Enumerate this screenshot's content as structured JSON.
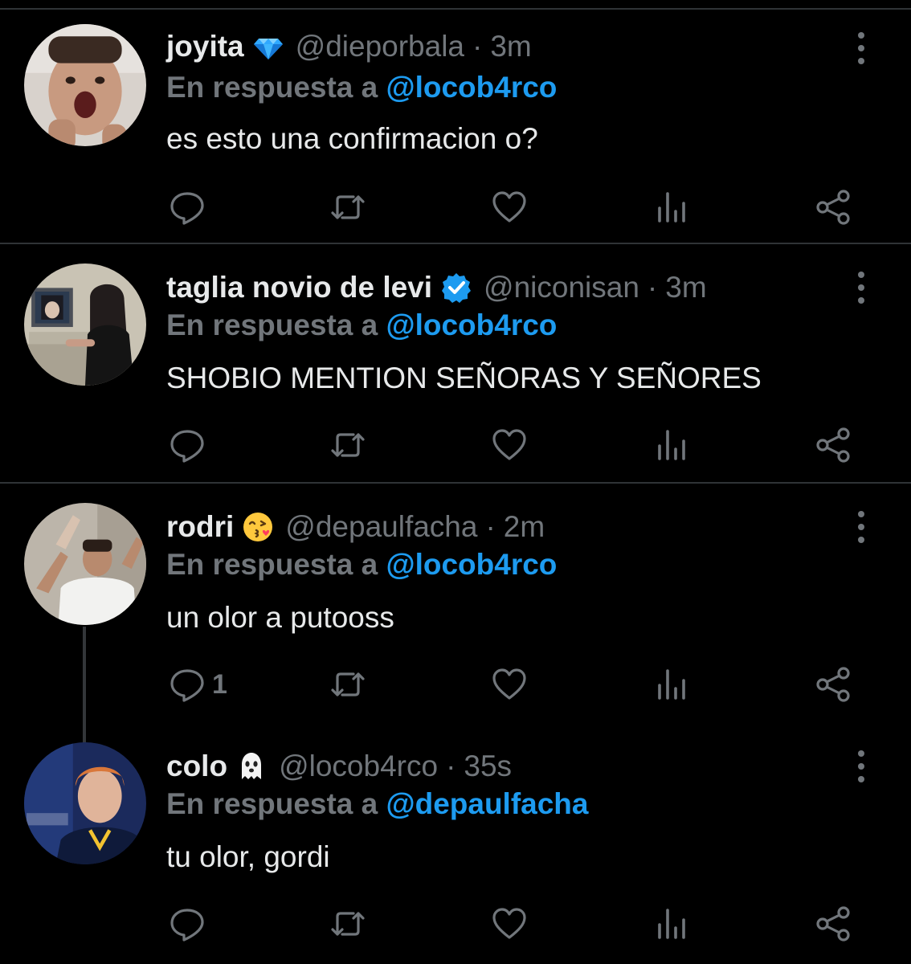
{
  "reply_prefix": "En respuesta a",
  "tweets": [
    {
      "name": "joyita",
      "badge": "gem-emoji",
      "handle": "@dieporbala",
      "separator": "·",
      "time": "3m",
      "reply_to": "@locob4rco",
      "text": "es esto una confirmacion o?",
      "reply_count": ""
    },
    {
      "name": "taglia novio de levi",
      "badge": "verified-badge",
      "handle": "@niconisan",
      "separator": "·",
      "time": "3m",
      "reply_to": "@locob4rco",
      "text": "SHOBIO MENTION SEÑORAS Y SEÑORES",
      "reply_count": ""
    },
    {
      "name": "rodri",
      "badge": "kiss-emoji",
      "handle": "@depaulfacha",
      "separator": "·",
      "time": "2m",
      "reply_to": "@locob4rco",
      "text": "un olor a putooss",
      "reply_count": "1"
    },
    {
      "name": "colo",
      "badge": "ghost-emoji",
      "handle": "@locob4rco",
      "separator": "·",
      "time": "35s",
      "reply_to": "@depaulfacha",
      "text": "tu olor, gordi",
      "reply_count": ""
    }
  ],
  "colors": {
    "background": "#000000",
    "text": "#e7e9ea",
    "muted": "#71767b",
    "link": "#1d9bf0",
    "divider": "#2f3336"
  }
}
